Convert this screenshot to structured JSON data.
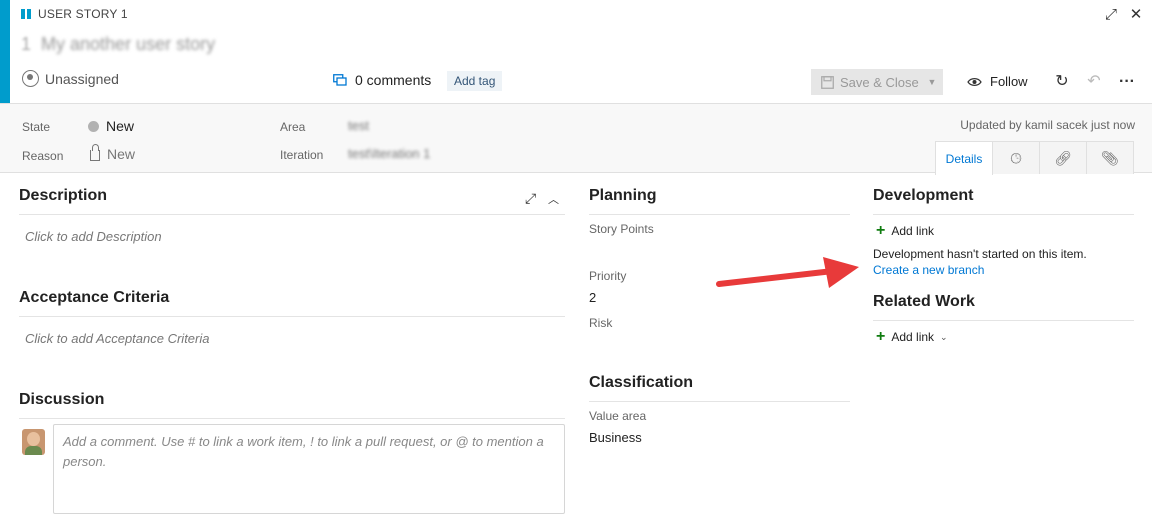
{
  "colors": {
    "accent": "#009ccc",
    "link": "#0078d4",
    "add_green": "#107c10",
    "arrow": "#e83a3a"
  },
  "header": {
    "type_label": "USER STORY 1",
    "work_item_id": "1",
    "title": "My another user story",
    "assigned": "Unassigned",
    "comments": "0 comments",
    "add_tag": "Add tag",
    "save_close": "Save & Close",
    "follow": "Follow"
  },
  "fields": {
    "state_label": "State",
    "state_value": "New",
    "reason_label": "Reason",
    "reason_value": "New",
    "area_label": "Area",
    "area_value": "test",
    "iteration_label": "Iteration",
    "iteration_value": "test\\Iteration 1",
    "updated": "Updated by kamil sacek just now"
  },
  "tabs": {
    "details": "Details"
  },
  "description": {
    "title": "Description",
    "placeholder": "Click to add Description"
  },
  "acceptance": {
    "title": "Acceptance Criteria",
    "placeholder": "Click to add Acceptance Criteria"
  },
  "discussion": {
    "title": "Discussion",
    "placeholder": "Add a comment. Use # to link a work item, ! to link a pull request, or @ to mention a person."
  },
  "planning": {
    "title": "Planning",
    "story_points_label": "Story Points",
    "priority_label": "Priority",
    "priority_value": "2",
    "risk_label": "Risk"
  },
  "classification": {
    "title": "Classification",
    "value_area_label": "Value area",
    "value_area_value": "Business"
  },
  "development": {
    "title": "Development",
    "add_link": "Add link",
    "message": "Development hasn't started on this item.",
    "create_branch": "Create a new branch"
  },
  "related": {
    "title": "Related Work",
    "add_link": "Add link"
  }
}
